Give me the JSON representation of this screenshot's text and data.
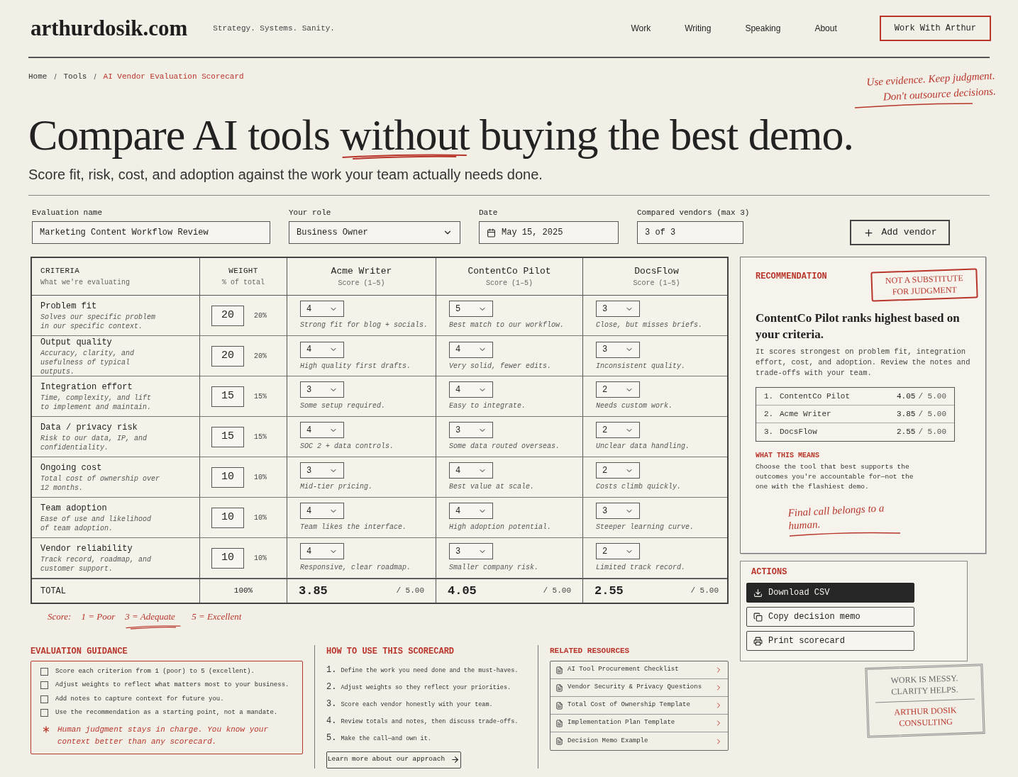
{
  "header": {
    "logo": "arthurdosik.com",
    "tagline": "Strategy. Systems. Sanity.",
    "nav": [
      "Work",
      "Writing",
      "Speaking",
      "About"
    ],
    "cta": "Work With Arthur"
  },
  "breadcrumb": [
    {
      "label": "Home",
      "current": false
    },
    {
      "label": "Tools",
      "current": false
    },
    {
      "label": "AI Vendor Evaluation Scorecard",
      "current": true
    }
  ],
  "breadcrumb_separator": "/",
  "margin_note": [
    "Use evidence. Keep judgment.",
    "Don't outsource decisions."
  ],
  "hero": {
    "title_parts": [
      {
        "text": "Compare AI tools ",
        "underlined": false
      },
      {
        "text": "without",
        "underlined": true
      },
      {
        "text": " buying the best demo.",
        "underlined": false
      }
    ],
    "subtitle": "Score fit, risk, cost, and adoption against the work your team actually needs done."
  },
  "form": {
    "fields": [
      {
        "label": "Evaluation name",
        "value": "Marketing Content Workflow Review",
        "kind": "text"
      },
      {
        "label": "Your role",
        "value": "Business Owner",
        "kind": "select"
      },
      {
        "label": "Date",
        "value": "May 15, 2025",
        "kind": "date"
      },
      {
        "label": "Compared vendors (max 3)",
        "value": "3 of 3",
        "kind": "text"
      }
    ],
    "add_button": "Add vendor"
  },
  "table": {
    "columns": [
      {
        "title": "CRITERIA",
        "subtitle": "What we're evaluating",
        "kind": "label"
      },
      {
        "title": "WEIGHT",
        "subtitle": "% of total",
        "kind": "weight"
      },
      {
        "title": "Acme Writer",
        "subtitle": "Score (1–5)",
        "kind": "vendor"
      },
      {
        "title": "ContentCo Pilot",
        "subtitle": "Score (1–5)",
        "kind": "vendor"
      },
      {
        "title": "DocsFlow",
        "subtitle": "Score (1–5)",
        "kind": "vendor"
      }
    ],
    "rows": [
      {
        "name": "Problem fit",
        "description": "Solves our specific problem in our specific context.",
        "weight": "20",
        "weight_pct": "20%",
        "scores": [
          {
            "value": "4",
            "note": "Strong fit for blog + socials."
          },
          {
            "value": "5",
            "note": "Best match to our workflow."
          },
          {
            "value": "3",
            "note": "Close, but misses briefs."
          }
        ]
      },
      {
        "name": "Output quality",
        "description": "Accuracy, clarity, and usefulness of typical outputs.",
        "weight": "20",
        "weight_pct": "20%",
        "scores": [
          {
            "value": "4",
            "note": "High quality first drafts."
          },
          {
            "value": "4",
            "note": "Very solid, fewer edits."
          },
          {
            "value": "3",
            "note": "Inconsistent quality."
          }
        ]
      },
      {
        "name": "Integration effort",
        "description": "Time, complexity, and lift to implement and maintain.",
        "weight": "15",
        "weight_pct": "15%",
        "scores": [
          {
            "value": "3",
            "note": "Some setup required."
          },
          {
            "value": "4",
            "note": "Easy to integrate."
          },
          {
            "value": "2",
            "note": "Needs custom work."
          }
        ]
      },
      {
        "name": "Data / privacy risk",
        "description": "Risk to our data, IP, and confidentiality.",
        "weight": "15",
        "weight_pct": "15%",
        "scores": [
          {
            "value": "4",
            "note": "SOC 2 + data controls."
          },
          {
            "value": "3",
            "note": "Some data routed overseas."
          },
          {
            "value": "2",
            "note": "Unclear data handling."
          }
        ]
      },
      {
        "name": "Ongoing cost",
        "description": "Total cost of ownership over 12 months.",
        "weight": "10",
        "weight_pct": "10%",
        "scores": [
          {
            "value": "3",
            "note": "Mid-tier pricing."
          },
          {
            "value": "4",
            "note": "Best value at scale."
          },
          {
            "value": "2",
            "note": "Costs climb quickly."
          }
        ]
      },
      {
        "name": "Team adoption",
        "description": "Ease of use and likelihood of team adoption.",
        "weight": "10",
        "weight_pct": "10%",
        "scores": [
          {
            "value": "4",
            "note": "Team likes the interface."
          },
          {
            "value": "4",
            "note": "High adoption potential."
          },
          {
            "value": "3",
            "note": "Steeper learning curve."
          }
        ]
      },
      {
        "name": "Vendor reliability",
        "description": "Track record, roadmap, and customer support.",
        "weight": "10",
        "weight_pct": "10%",
        "scores": [
          {
            "value": "4",
            "note": "Responsive, clear roadmap."
          },
          {
            "value": "3",
            "note": "Smaller company risk."
          },
          {
            "value": "2",
            "note": "Limited track record."
          }
        ]
      }
    ],
    "total": {
      "label": "TOTAL",
      "weight": "100%",
      "scores": [
        {
          "value": "3.85",
          "max": "/ 5.00"
        },
        {
          "value": "4.05",
          "max": "/ 5.00"
        },
        {
          "value": "2.55",
          "max": "/ 5.00"
        }
      ]
    }
  },
  "score_legend": [
    {
      "text": "Score:",
      "underlined": false
    },
    {
      "text": "1 = Poor",
      "underlined": false
    },
    {
      "text": "3 = Adequate",
      "underlined": true
    },
    {
      "text": "5 = Excellent",
      "underlined": false
    }
  ],
  "recommendation": {
    "heading": "RECOMMENDATION",
    "stamp": "NOT A SUBSTITUTE FOR JUDGMENT",
    "headline": "ContentCo Pilot ranks highest based on your criteria.",
    "body": "It scores strongest on problem fit, integration effort, cost, and adoption. Review the notes and trade-offs with your team.",
    "ranking": [
      {
        "rank": "1.",
        "name": "ContentCo Pilot",
        "score": "4.05",
        "max": "/ 5.00"
      },
      {
        "rank": "2.",
        "name": "Acme Writer",
        "score": "3.85",
        "max": "/ 5.00"
      },
      {
        "rank": "3.",
        "name": "DocsFlow",
        "score": "2.55",
        "max": "/ 5.00"
      }
    ],
    "means_heading": "WHAT THIS MEANS",
    "means_body": "Choose the tool that best supports the outcomes you're accountable for—not the one with the flashiest demo.",
    "note": "Final call belongs to a human."
  },
  "actions": {
    "heading": "ACTIONS",
    "buttons": [
      {
        "label": "Download CSV",
        "primary": true
      },
      {
        "label": "Copy decision memo",
        "primary": false
      },
      {
        "label": "Print scorecard",
        "primary": false
      }
    ]
  },
  "brand_stamp": {
    "motto": "WORK IS MESSY. CLARITY HELPS.",
    "name": "ARTHUR DOSIK CONSULTING"
  },
  "guidance": {
    "heading": "EVALUATION GUIDANCE",
    "items": [
      {
        "text": "Score each criterion from 1 (poor) to 5 (excellent).",
        "checked": false
      },
      {
        "text": "Adjust weights to reflect what matters most to your business.",
        "checked": false
      },
      {
        "text": "Add notes to capture context for future you.",
        "checked": false
      },
      {
        "text": "Use the recommendation as a starting point, not a mandate.",
        "checked": false
      }
    ],
    "note": "Human judgment stays in charge. You know your context better than any scorecard."
  },
  "how_to": {
    "heading": "HOW TO USE THIS SCORECARD",
    "steps": [
      {
        "number": "1.",
        "text": "Define the work you need done and the must-haves."
      },
      {
        "number": "2.",
        "text": "Adjust weights so they reflect your priorities."
      },
      {
        "number": "3.",
        "text": "Score each vendor honestly with your team."
      },
      {
        "number": "4.",
        "text": "Review totals and notes, then discuss trade-offs."
      },
      {
        "number": "5.",
        "text": "Make the call—and own it."
      }
    ],
    "link": "Learn more about our approach"
  },
  "resources": {
    "heading": "RELATED RESOURCES",
    "items": [
      "AI Tool Procurement Checklist",
      "Vendor Security & Privacy Questions",
      "Total Cost of Ownership Template",
      "Implementation Plan Template",
      "Decision Memo Example"
    ]
  }
}
